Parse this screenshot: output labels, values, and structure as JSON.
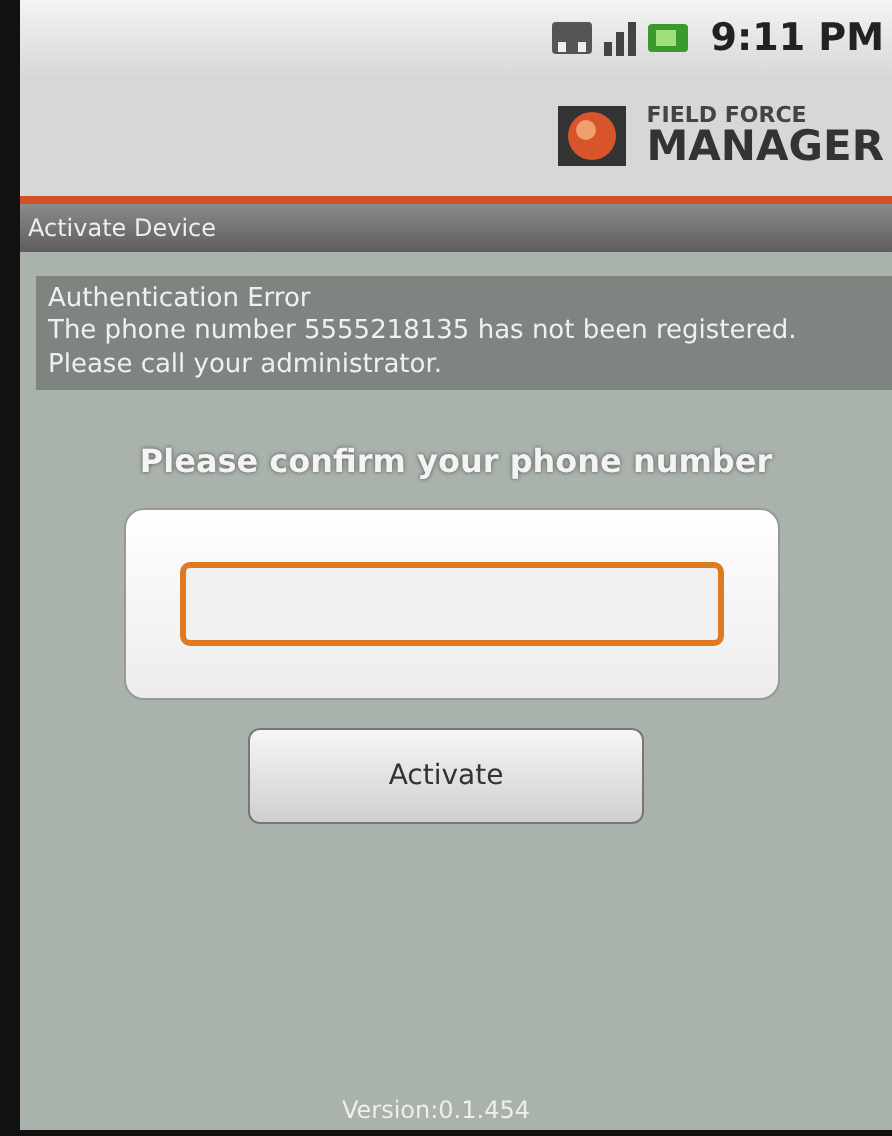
{
  "status_bar": {
    "time": "9:11 PM"
  },
  "header": {
    "logo_line_1": "FIELD FORCE",
    "logo_line_2": "MANAGER"
  },
  "title_bar": {
    "title": "Activate Device"
  },
  "error": {
    "title": "Authentication Error",
    "message": "The phone number 5555218135 has not been registered.  Please call your administrator."
  },
  "prompt": "Please confirm your phone number",
  "phone_field": {
    "focused": true
  },
  "activate_button": "Activate",
  "version": "Version:0.1.454"
}
